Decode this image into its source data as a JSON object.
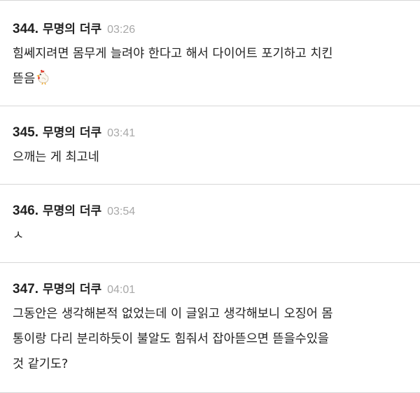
{
  "comments": [
    {
      "number": "344.",
      "author": "무명의 더쿠",
      "time": "03:26",
      "lines": [
        "힘쎄지려면 몸무게 늘려야 한다고 해서 다이어트 포기하고 치킨",
        "뜯음"
      ],
      "trailing_icon": "chicken-icon"
    },
    {
      "number": "345.",
      "author": "무명의 더쿠",
      "time": "03:41",
      "lines": [
        "으깨는 게 최고네"
      ]
    },
    {
      "number": "346.",
      "author": "무명의 더쿠",
      "time": "03:54",
      "lines": [
        "ㅅ"
      ]
    },
    {
      "number": "347.",
      "author": "무명의 더쿠",
      "time": "04:01",
      "lines": [
        "그동안은 생각해본적 없었는데 이 글읽고 생각해보니 오징어 몸",
        "통이랑 다리 분리하듯이 불알도 힘줘서 잡아뜯으면 뜯을수있을",
        "것 같기도?"
      ]
    }
  ]
}
